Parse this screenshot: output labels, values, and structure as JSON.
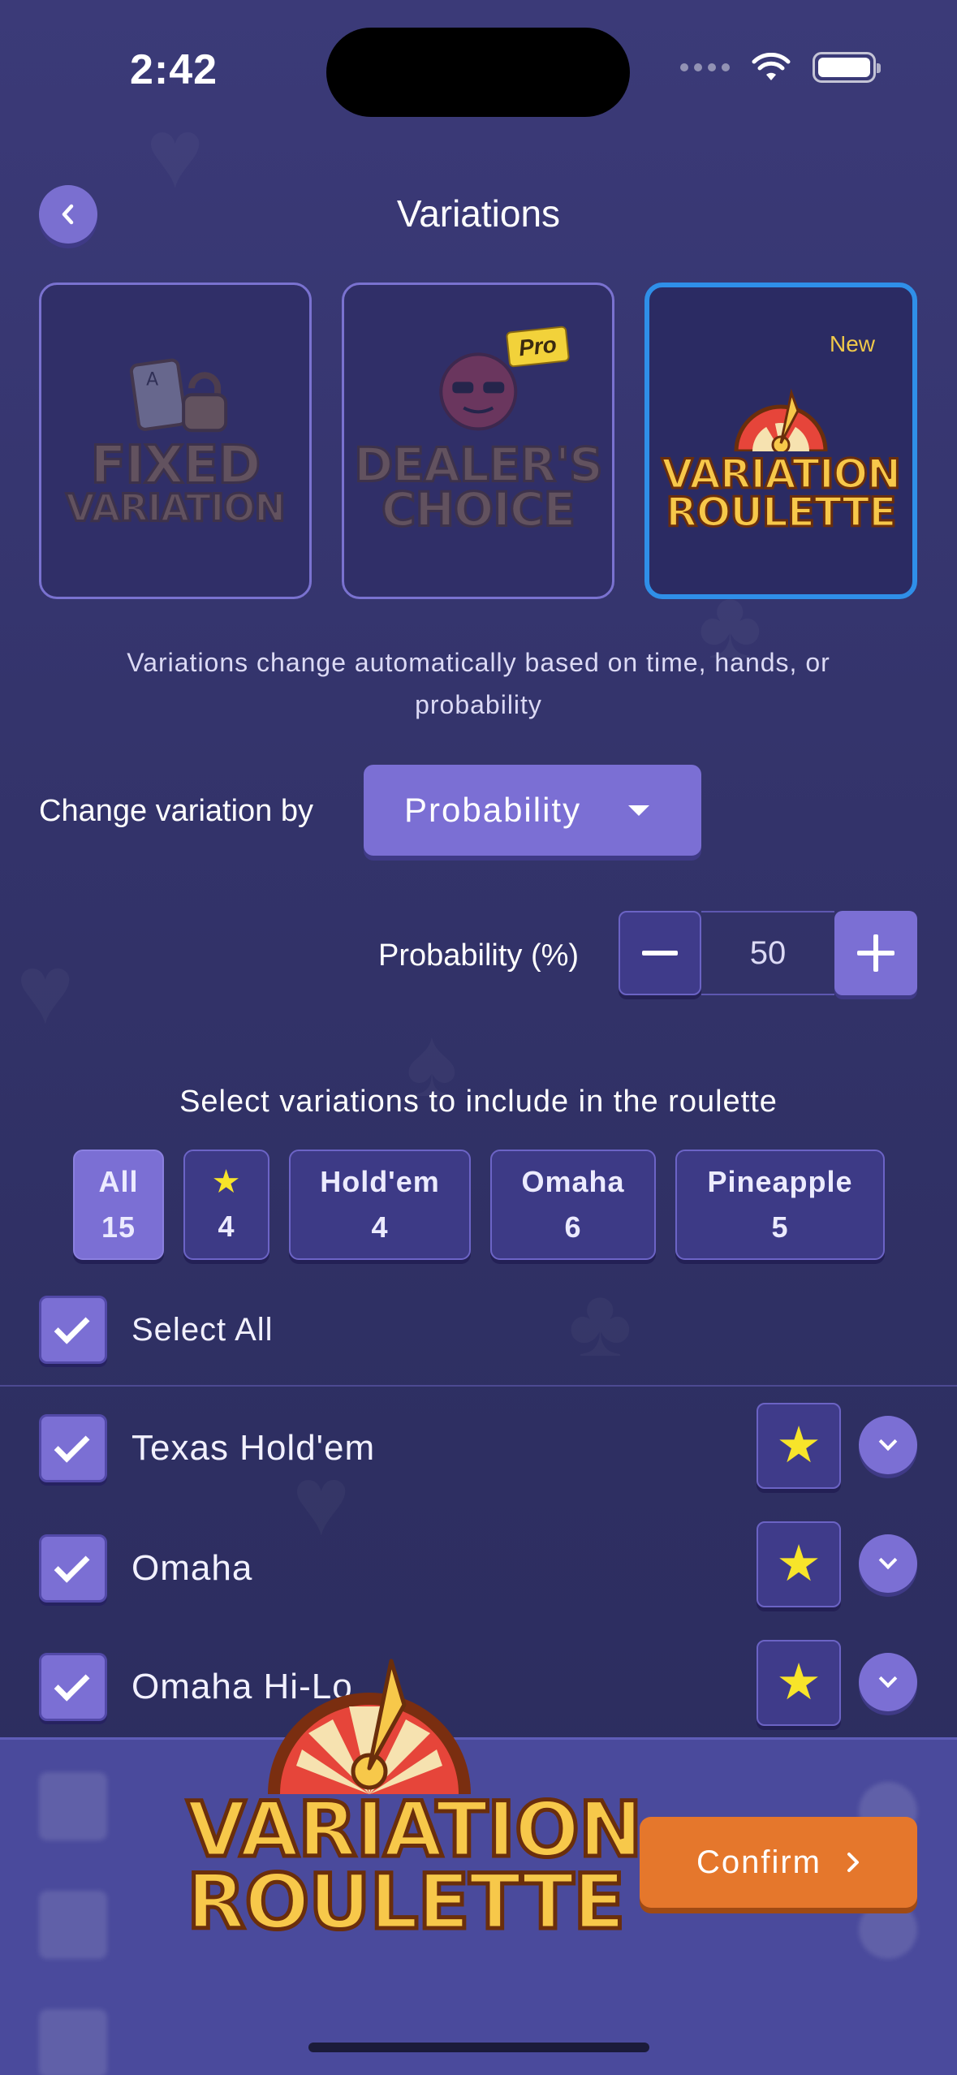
{
  "status_bar": {
    "time": "2:42"
  },
  "header": {
    "title": "Variations",
    "back_icon": "chevron-left-icon"
  },
  "modes": [
    {
      "name": "fixed",
      "logo_line1": "FIXED",
      "logo_line2": "VARIATION",
      "badge": ""
    },
    {
      "name": "dealers-choice",
      "logo_line1": "DEALER'S",
      "logo_line2": "CHOICE",
      "badge": "Pro"
    },
    {
      "name": "roulette",
      "logo_line1": "VARIATION",
      "logo_line2": "ROULETTE",
      "badge": "New",
      "selected": true
    }
  ],
  "description": "Variations change automatically based on time, hands, or probability",
  "change_by": {
    "label": "Change variation by",
    "value": "Probability"
  },
  "probability": {
    "label": "Probability (%)",
    "value": "50"
  },
  "select_title": "Select variations to include in the roulette",
  "filters": [
    {
      "label": "All",
      "count": "15",
      "active": true
    },
    {
      "label": "★",
      "count": "4",
      "active": false
    },
    {
      "label": "Hold'em",
      "count": "4",
      "active": false
    },
    {
      "label": "Omaha",
      "count": "6",
      "active": false
    },
    {
      "label": "Pineapple",
      "count": "5",
      "active": false
    }
  ],
  "select_all_label": "Select All",
  "variations": [
    {
      "label": "Texas Hold'em",
      "checked": true,
      "favorite": true
    },
    {
      "label": "Omaha",
      "checked": true,
      "favorite": true
    },
    {
      "label": "Omaha Hi-Lo",
      "checked": true,
      "favorite": true
    }
  ],
  "footer": {
    "confirm_label": "Confirm",
    "logo_line1": "VARIATION",
    "logo_line2": "ROULETTE"
  },
  "colors": {
    "background": "#353468",
    "accent": "#7b6fd4",
    "selected_border": "#2f8fe8",
    "confirm": "#e5772c",
    "star": "#f7e42a"
  }
}
